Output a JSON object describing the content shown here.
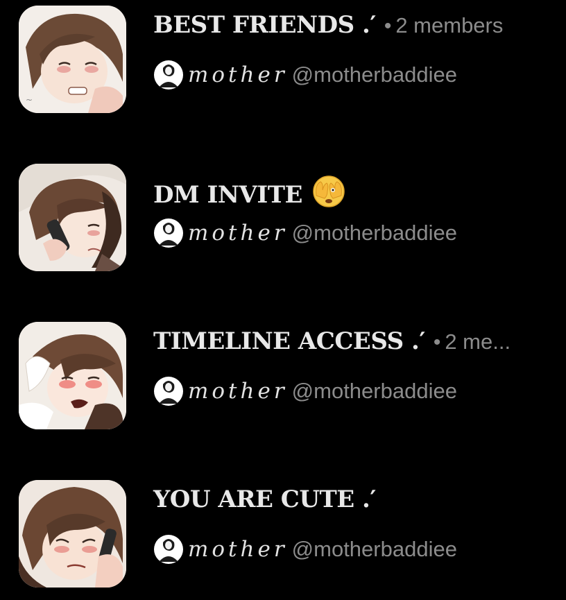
{
  "theme": {
    "background": "#000000",
    "title_color": "#e8e8e8",
    "muted_color": "#8c8c8c"
  },
  "groups": [
    {
      "title": "BEST FRIENDS .′",
      "separator": "•",
      "member_count": "2 members",
      "owner_name": "mother",
      "owner_handle": "@motherbaddiee",
      "thumbnail_icon": "group-avatar-image"
    },
    {
      "title": "DM INVITE",
      "title_emoji": "face-with-peeking-eye-emoji",
      "owner_name": "mother",
      "owner_handle": "@motherbaddiee",
      "thumbnail_icon": "group-avatar-image"
    },
    {
      "title": "TIMELINE ACCESS .′",
      "separator": "•",
      "member_count": "2 me...",
      "owner_name": "mother",
      "owner_handle": "@motherbaddiee",
      "thumbnail_icon": "group-avatar-image"
    },
    {
      "title": "YOU ARE CUTE .′",
      "owner_name": "mother",
      "owner_handle": "@motherbaddiee",
      "thumbnail_icon": "group-avatar-image"
    }
  ]
}
